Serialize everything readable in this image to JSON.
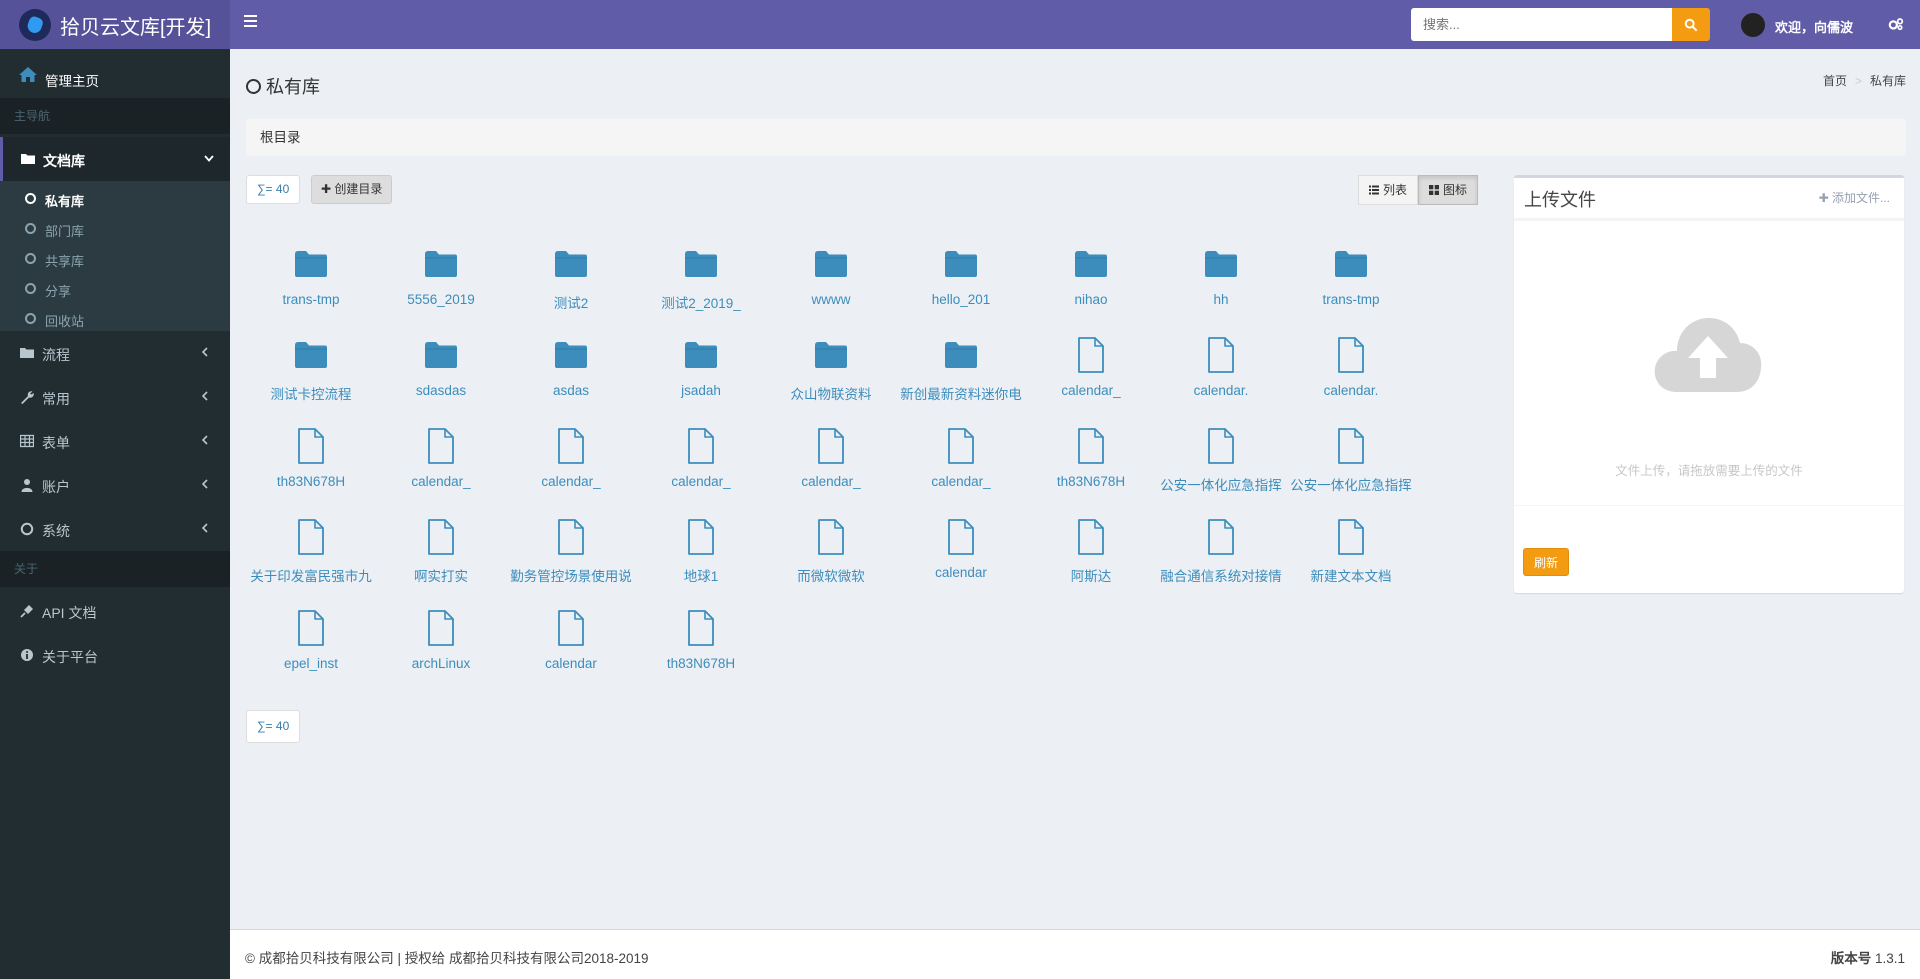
{
  "header": {
    "app_title": "拾贝云文库[开发]",
    "search_placeholder": "搜索...",
    "welcome": "欢迎，向儒波"
  },
  "sidebar": {
    "home_label": "管理主页",
    "main_nav_header": "主导航",
    "doc_library": "文档库",
    "sub_items": [
      "私有库",
      "部门库",
      "共享库",
      "分享",
      "回收站"
    ],
    "flow": "流程",
    "common": "常用",
    "forms": "表单",
    "account": "账户",
    "system": "系统",
    "about_header": "关于",
    "api_docs": "API 文档",
    "about_platform": "关于平台"
  },
  "page": {
    "title": "私有库",
    "breadcrumb_home": "首页",
    "breadcrumb_sep": ">",
    "breadcrumb_current": "私有库",
    "path": "根目录",
    "count_label": "∑= 40",
    "create_dir": "创建目录",
    "view_list": "列表",
    "view_icon": "图标"
  },
  "files": [
    {
      "name": "trans-tmp",
      "type": "folder"
    },
    {
      "name": "5556_2019",
      "type": "folder"
    },
    {
      "name": "测试2",
      "type": "folder"
    },
    {
      "name": "测试2_2019_",
      "type": "folder"
    },
    {
      "name": "wwww",
      "type": "folder"
    },
    {
      "name": "hello_201",
      "type": "folder"
    },
    {
      "name": "nihao",
      "type": "folder"
    },
    {
      "name": "hh",
      "type": "folder"
    },
    {
      "name": "trans-tmp",
      "type": "folder"
    },
    {
      "name": "测试卡控流程",
      "type": "folder"
    },
    {
      "name": "sdasdas",
      "type": "folder"
    },
    {
      "name": "asdas",
      "type": "folder"
    },
    {
      "name": "jsadah",
      "type": "folder"
    },
    {
      "name": "众山物联资料",
      "type": "folder"
    },
    {
      "name": "新创最新资料迷你电",
      "type": "folder"
    },
    {
      "name": "calendar_",
      "type": "file"
    },
    {
      "name": "calendar.",
      "type": "file"
    },
    {
      "name": "calendar.",
      "type": "file"
    },
    {
      "name": "th83N678H",
      "type": "file"
    },
    {
      "name": "calendar_",
      "type": "file"
    },
    {
      "name": "calendar_",
      "type": "file"
    },
    {
      "name": "calendar_",
      "type": "file"
    },
    {
      "name": "calendar_",
      "type": "file"
    },
    {
      "name": "calendar_",
      "type": "file"
    },
    {
      "name": "th83N678H",
      "type": "file"
    },
    {
      "name": "公安一体化应急指挥",
      "type": "file"
    },
    {
      "name": "公安一体化应急指挥",
      "type": "file"
    },
    {
      "name": "关于印发富民强市九",
      "type": "file"
    },
    {
      "name": "啊实打实",
      "type": "file"
    },
    {
      "name": "勤务管控场景使用说",
      "type": "file"
    },
    {
      "name": "地球1",
      "type": "file"
    },
    {
      "name": "而微软微软",
      "type": "file"
    },
    {
      "name": "calendar",
      "type": "file"
    },
    {
      "name": "阿斯达",
      "type": "file"
    },
    {
      "name": "融合通信系统对接情",
      "type": "file"
    },
    {
      "name": "新建文本文档",
      "type": "file"
    },
    {
      "name": "epel_inst",
      "type": "file"
    },
    {
      "name": "archLinux",
      "type": "file"
    },
    {
      "name": "calendar",
      "type": "file"
    },
    {
      "name": "th83N678H",
      "type": "file"
    }
  ],
  "upload": {
    "title": "上传文件",
    "add_file": "添加文件...",
    "drop_hint": "文件上传，请拖放需要上传的文件",
    "refresh": "刷新"
  },
  "footer": {
    "copyright": "© 成都拾贝科技有限公司 | 授权给 成都拾贝科技有限公司2018-2019",
    "version_label": "版本号",
    "version": "1.3.1"
  },
  "colors": {
    "header": "#605ca8",
    "sidebar": "#222d32",
    "accent": "#f39c12",
    "link": "#3c8dbc",
    "folder": "#3c8dbc"
  }
}
